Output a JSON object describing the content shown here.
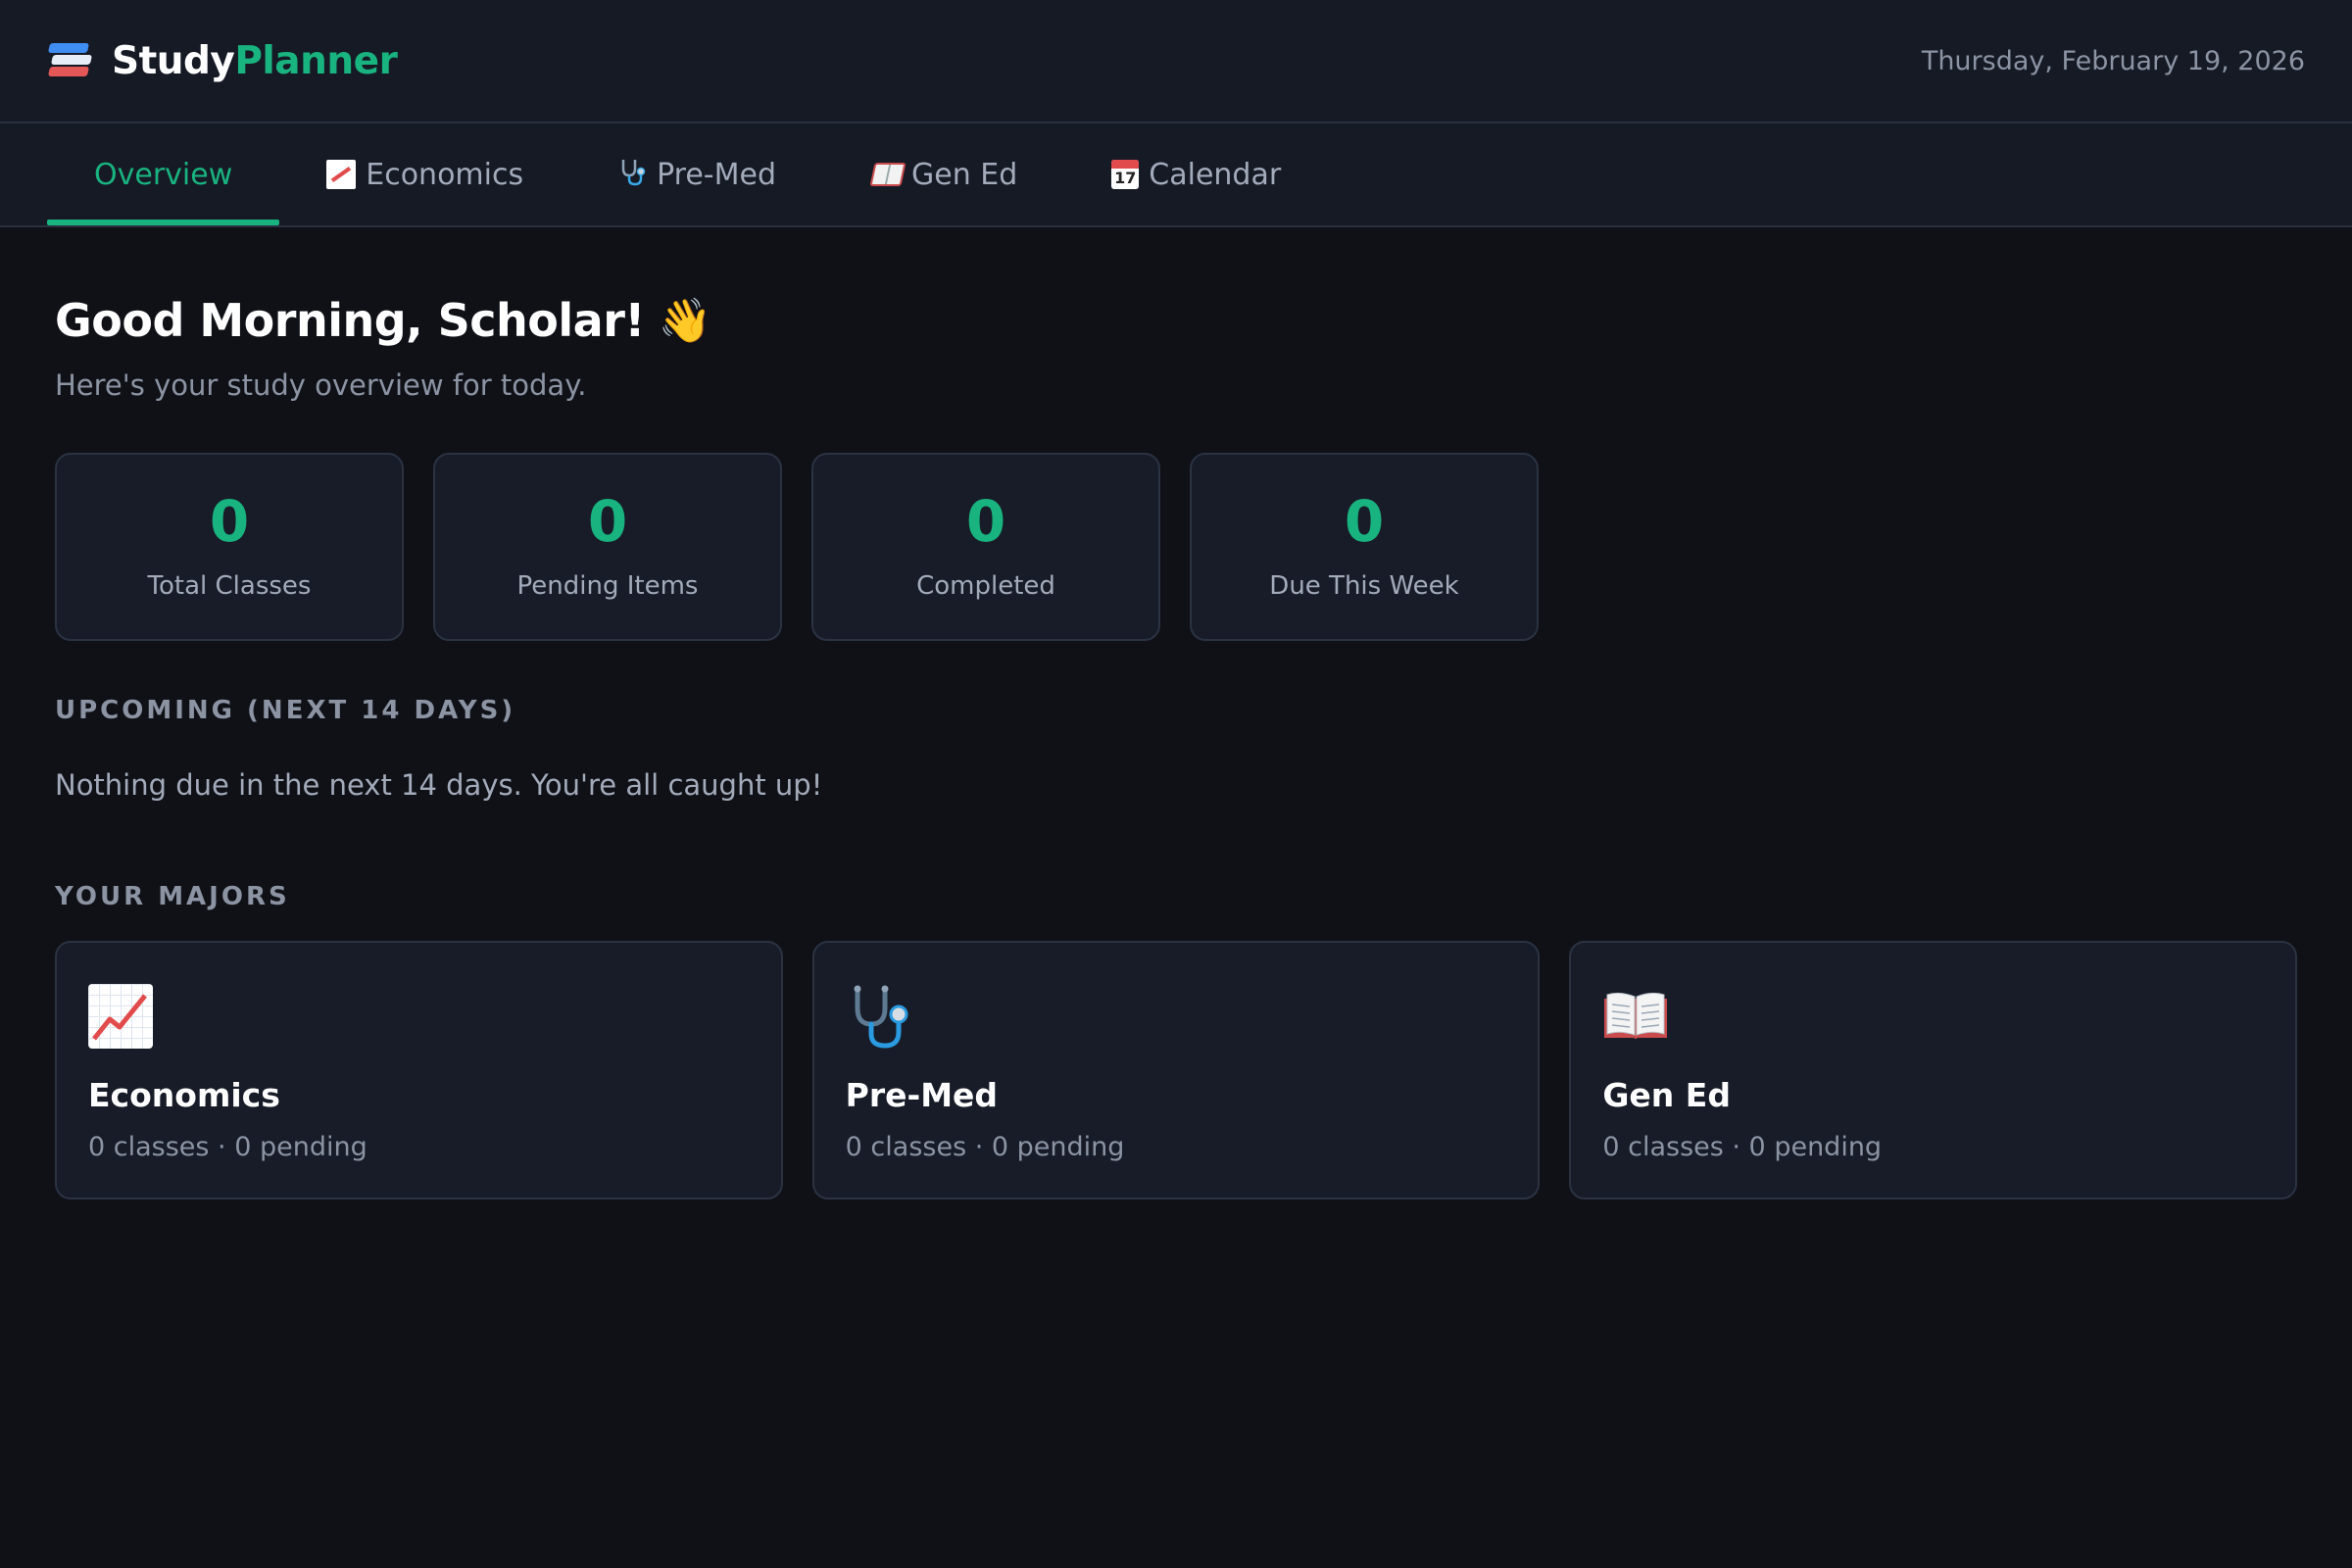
{
  "app": {
    "brand_part1": "Study",
    "brand_part2": "Planner",
    "date": "Thursday, February 19, 2026",
    "accent_color": "#19b37f"
  },
  "tabs": [
    {
      "label": "Overview",
      "icon": "",
      "active": true
    },
    {
      "label": "Economics",
      "icon": "chart-increasing-icon",
      "active": false
    },
    {
      "label": "Pre-Med",
      "icon": "stethoscope-icon",
      "active": false
    },
    {
      "label": "Gen Ed",
      "icon": "open-book-icon",
      "active": false
    },
    {
      "label": "Calendar",
      "icon": "calendar-icon",
      "active": false
    }
  ],
  "greeting": {
    "title": "Good Morning, Scholar!",
    "emoji": "👋",
    "subtitle": "Here's your study overview for today."
  },
  "stats": [
    {
      "value": "0",
      "label": "Total Classes"
    },
    {
      "value": "0",
      "label": "Pending Items"
    },
    {
      "value": "0",
      "label": "Completed"
    },
    {
      "value": "0",
      "label": "Due This Week"
    }
  ],
  "upcoming": {
    "title": "UPCOMING (NEXT 14 DAYS)",
    "empty_message": "Nothing due in the next 14 days. You're all caught up!"
  },
  "majors": {
    "title": "YOUR MAJORS",
    "items": [
      {
        "name": "Economics",
        "meta": "0 classes · 0 pending",
        "icon": "chart-increasing-icon"
      },
      {
        "name": "Pre-Med",
        "meta": "0 classes · 0 pending",
        "icon": "stethoscope-icon"
      },
      {
        "name": "Gen Ed",
        "meta": "0 classes · 0 pending",
        "icon": "open-book-icon"
      }
    ]
  }
}
